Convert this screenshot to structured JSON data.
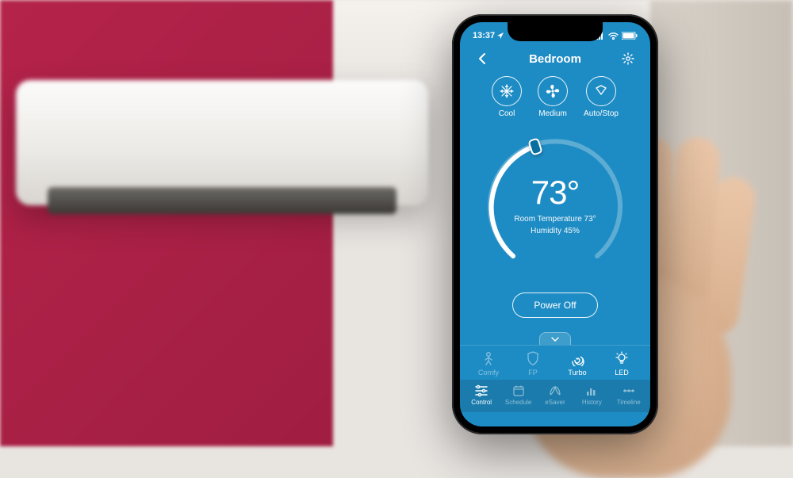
{
  "status_bar": {
    "time": "13:37",
    "location_icon": "location-arrow",
    "signal_icon": "signal",
    "wifi_icon": "wifi",
    "battery_icon": "battery"
  },
  "header": {
    "back_icon": "chevron-left",
    "title": "Bedroom",
    "settings_icon": "gear"
  },
  "modes": [
    {
      "id": "cool",
      "label": "Cool",
      "icon": "snowflake"
    },
    {
      "id": "medium",
      "label": "Medium",
      "icon": "fan"
    },
    {
      "id": "autostop",
      "label": "Auto/Stop",
      "icon": "swing"
    }
  ],
  "dial": {
    "set_temp_display": "73°",
    "room_temp_label": "Room Temperature 73°",
    "humidity_label": "Humidity 45%",
    "progress_pct": 42
  },
  "power": {
    "label": "Power Off"
  },
  "expand": {
    "icon": "chevron-down"
  },
  "quick_actions": [
    {
      "id": "comfy",
      "label": "Comfy",
      "icon": "person",
      "active": false
    },
    {
      "id": "fp",
      "label": "FP",
      "icon": "shield",
      "active": false
    },
    {
      "id": "turbo",
      "label": "Turbo",
      "icon": "spiral",
      "active": true
    },
    {
      "id": "led",
      "label": "LED",
      "icon": "bulb",
      "active": true
    }
  ],
  "tabs": [
    {
      "id": "control",
      "label": "Control",
      "icon": "sliders",
      "active": true
    },
    {
      "id": "schedule",
      "label": "Schedule",
      "icon": "calendar",
      "active": false
    },
    {
      "id": "esaver",
      "label": "eSaver",
      "icon": "leaf",
      "active": false
    },
    {
      "id": "history",
      "label": "History",
      "icon": "bars",
      "active": false
    },
    {
      "id": "timeline",
      "label": "Timeline",
      "icon": "timeline",
      "active": false
    }
  ],
  "colors": {
    "app_bg": "#1e8cc4",
    "dial_knob": "#0a6fa0"
  }
}
